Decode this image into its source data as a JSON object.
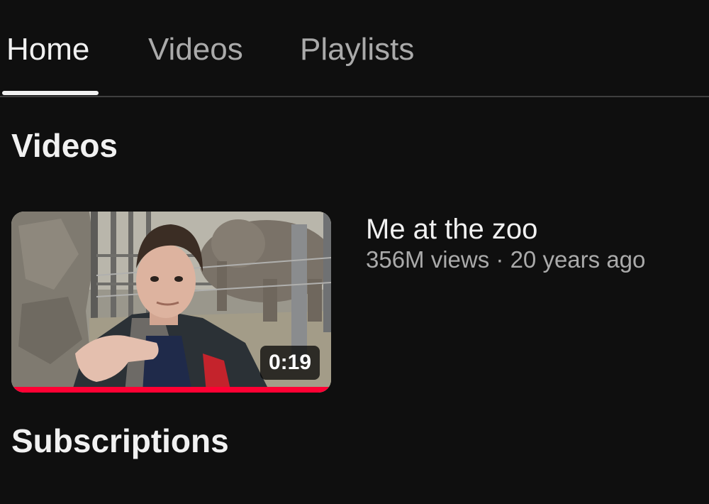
{
  "tabs": [
    {
      "label": "Home",
      "active": true
    },
    {
      "label": "Videos",
      "active": false
    },
    {
      "label": "Playlists",
      "active": false
    }
  ],
  "sections": {
    "videos_title": "Videos",
    "subscriptions_title": "Subscriptions"
  },
  "video": {
    "title": "Me at the zoo",
    "views": "356M views",
    "separator": "·",
    "age": "20 years ago",
    "duration": "0:19",
    "watched_fraction": 1.0
  },
  "colors": {
    "background": "#0f0f0f",
    "text_primary": "#f1f1f1",
    "text_secondary": "#aaaaaa",
    "progress": "#ff0033"
  }
}
